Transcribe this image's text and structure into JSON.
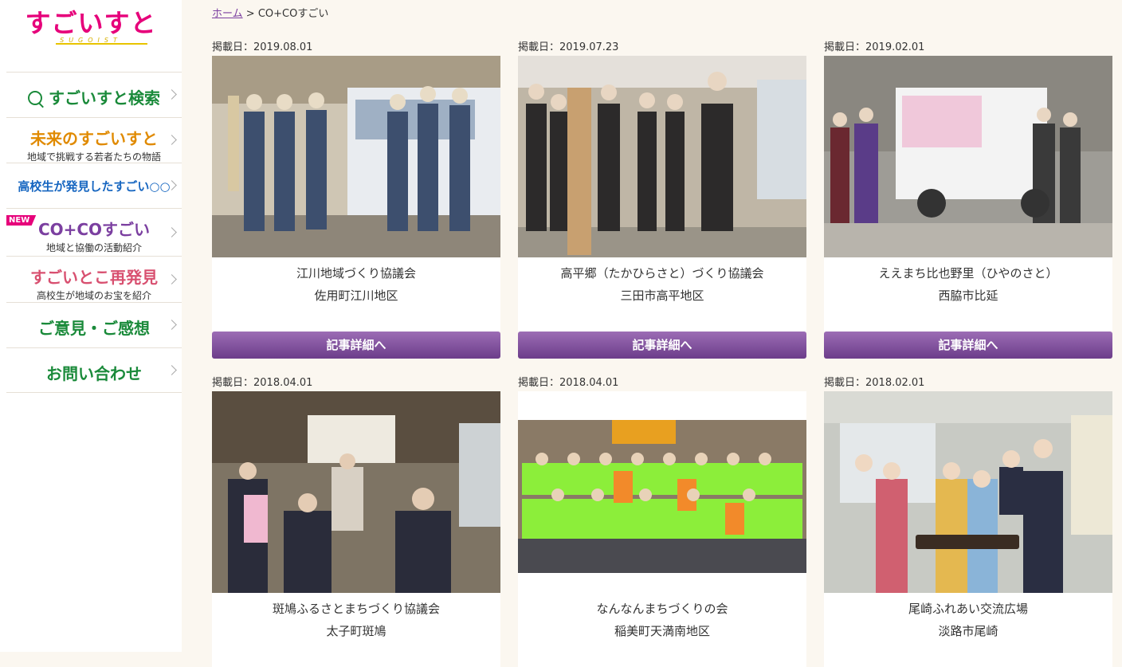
{
  "logo": {
    "text": "すごいすと",
    "sub": "SUGOIST"
  },
  "nav": {
    "search": {
      "label": "すごいすと検索"
    },
    "future": {
      "label": "未来のすごいすと",
      "sub": "地域で挑戦する若者たちの物語"
    },
    "highschool": {
      "label": "高校生が発見したすごい○○"
    },
    "coco": {
      "badge": "NEW",
      "label": "CO+COすごい",
      "sub": "地域と協働の活動紹介"
    },
    "rediscover": {
      "label": "すごいとこ再発見",
      "sub": "高校生が地域のお宝を紹介"
    },
    "opinion": {
      "label": "ご意見・ご感想"
    },
    "contact": {
      "label": "お問い合わせ"
    }
  },
  "breadcrumb": {
    "home": "ホーム",
    "separator": ">",
    "current": "CO+COすごい"
  },
  "button_label": "記事詳細へ",
  "cards": [
    {
      "date": "掲載日：2019.08.01",
      "title": "江川地域づくり協議会",
      "location": "佐用町江川地区"
    },
    {
      "date": "掲載日：2019.07.23",
      "title": "高平郷（たかひらさと）づくり協議会",
      "location": "三田市高平地区"
    },
    {
      "date": "掲載日：2019.02.01",
      "title": "ええまち比也野里（ひやのさと）",
      "location": "西脇市比延"
    },
    {
      "date": "掲載日：2018.04.01",
      "title": "斑鳩ふるさとまちづくり協議会",
      "location": "太子町斑鳩"
    },
    {
      "date": "掲載日：2018.04.01",
      "title": "なんなんまちづくりの会",
      "location": "稲美町天満南地区"
    },
    {
      "date": "掲載日：2018.02.01",
      "title": "尾崎ふれあい交流広場",
      "location": "淡路市尾崎"
    }
  ],
  "colors": {
    "accent": "#7b3fa0",
    "green": "#1a8a3a",
    "orange": "#e08a00",
    "pink": "#e6007a"
  }
}
